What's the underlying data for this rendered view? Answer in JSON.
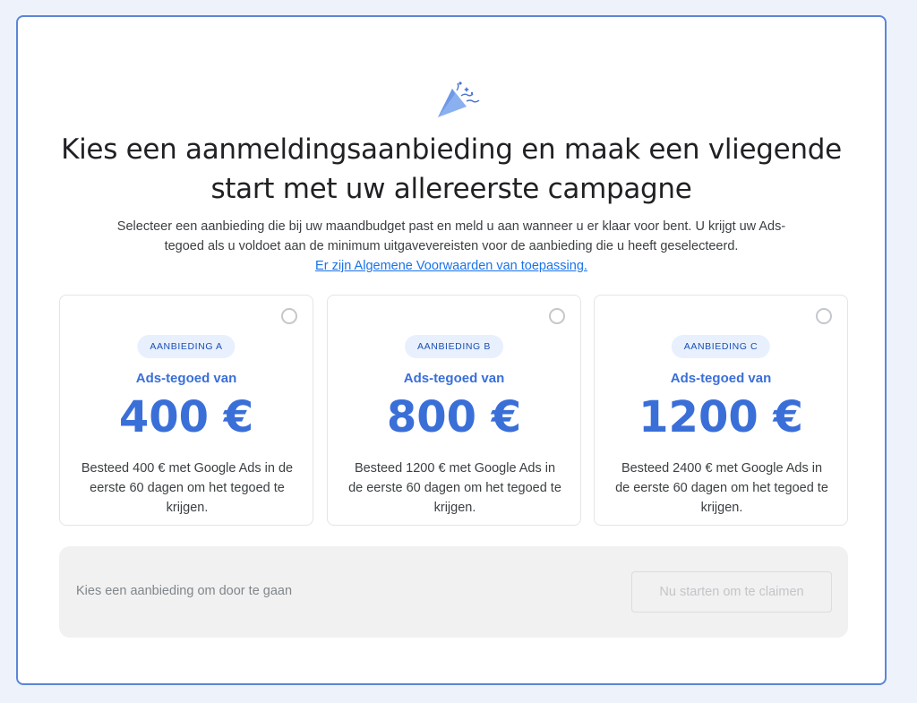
{
  "header": {
    "icon": "party-popper-icon",
    "title_line1": "Kies een aanmeldingsaanbieding en maak een vliegende",
    "title_line2": "start met uw allereerste campagne",
    "subtitle": "Selecteer een aanbieding die bij uw maandbudget past en meld u aan wanneer u er klaar voor bent. U krijgt uw Ads-tegoed als u voldoet aan de minimum uitgavevereisten voor de aanbieding die u heeft geselecteerd.",
    "terms_link": "Er zijn Algemene Voorwaarden van toepassing."
  },
  "offers": [
    {
      "badge": "AANBIEDING A",
      "credit_label": "Ads-tegoed van",
      "amount": "400 €",
      "description": "Besteed 400 € met Google Ads in de eerste 60 dagen om het tegoed te krijgen.",
      "selected": false
    },
    {
      "badge": "AANBIEDING B",
      "credit_label": "Ads-tegoed van",
      "amount": "800 €",
      "description": "Besteed 1200 € met Google Ads in de eerste 60 dagen om het tegoed te krijgen.",
      "selected": false
    },
    {
      "badge": "AANBIEDING C",
      "credit_label": "Ads-tegoed van",
      "amount": "1200 €",
      "description": "Besteed 2400 € met Google Ads in de eerste 60 dagen om het tegoed te krijgen.",
      "selected": false
    }
  ],
  "footer": {
    "prompt": "Kies een aanbieding om door te gaan",
    "claim_button": "Nu starten om te claimen",
    "claim_button_disabled": true
  },
  "colors": {
    "accent": "#3a6fd8",
    "badge_bg": "#e8f0fe",
    "dialog_border": "#5b86d6",
    "page_bg": "#edf2fb"
  }
}
